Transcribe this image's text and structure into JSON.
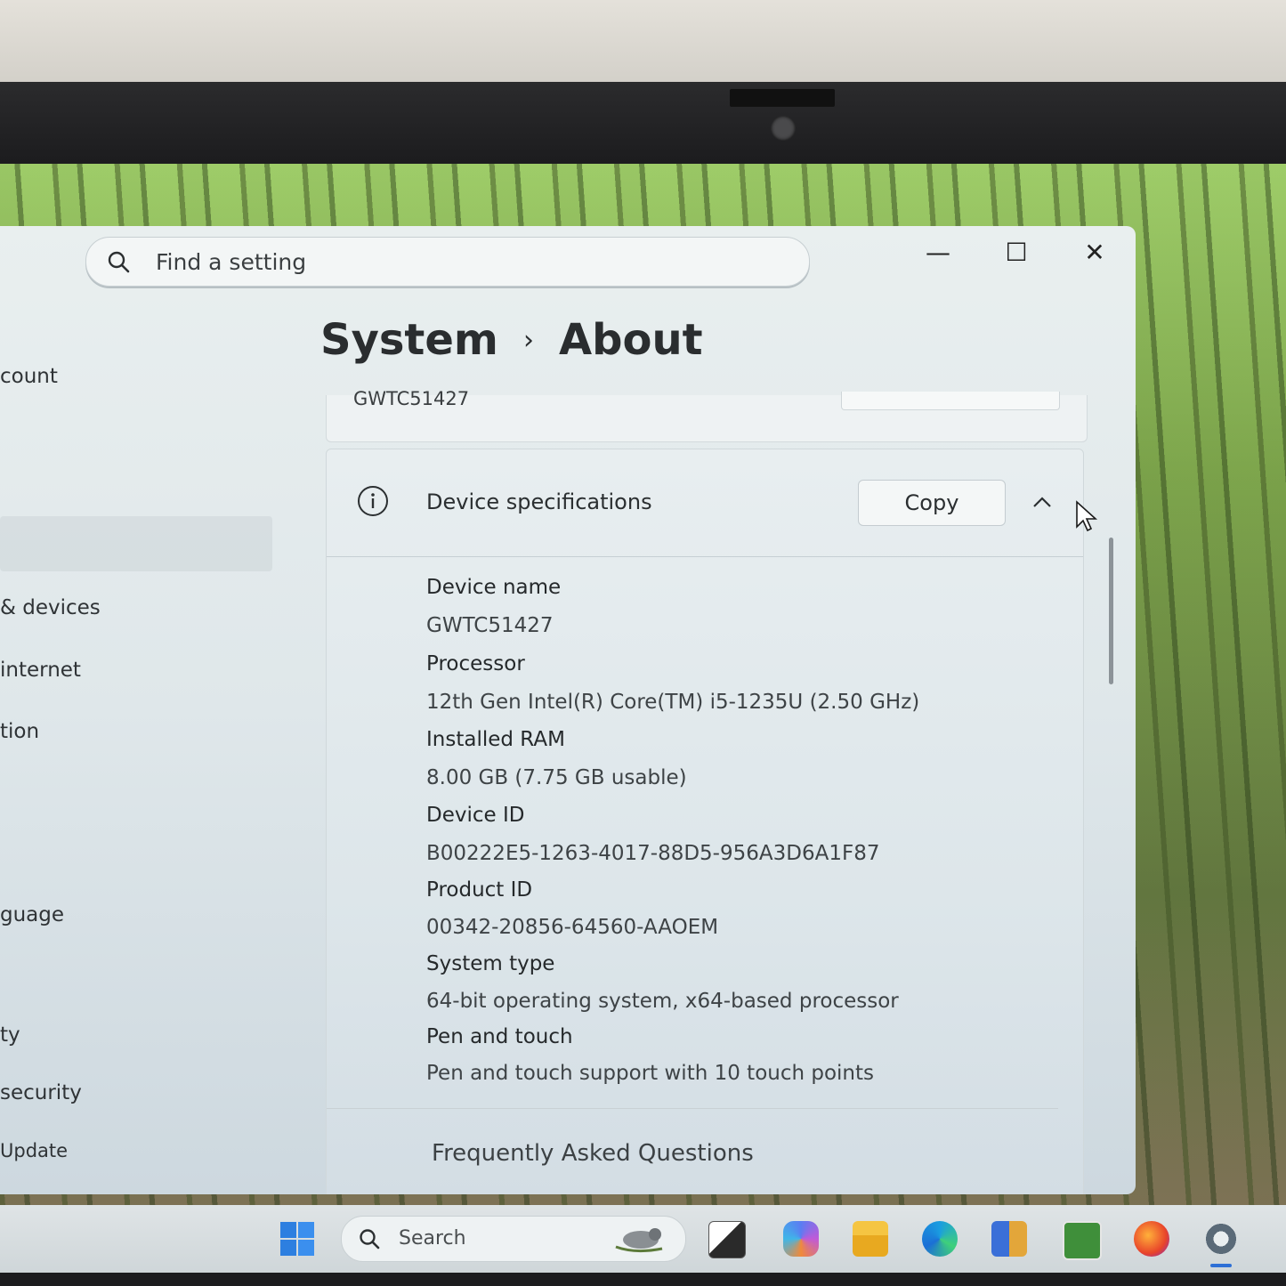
{
  "search": {
    "placeholder": "Find a setting"
  },
  "window_controls": {
    "minimize": "—",
    "maximize": "☐",
    "close": "✕"
  },
  "sidebar": {
    "items": [
      {
        "label": "count"
      },
      {
        "label": "& devices"
      },
      {
        "label": "internet"
      },
      {
        "label": "tion"
      },
      {
        "label": "guage"
      },
      {
        "label": "ty"
      },
      {
        "label": "security"
      },
      {
        "label": "Update"
      }
    ]
  },
  "breadcrumb": {
    "parent": "System",
    "separator": "›",
    "current": "About"
  },
  "top_card": {
    "device_name_value": "GWTC51427"
  },
  "specs": {
    "title": "Device specifications",
    "copy_label": "Copy",
    "rows": [
      {
        "label": "Device name",
        "value": "GWTC51427"
      },
      {
        "label": "Processor",
        "value": "12th Gen Intel(R) Core(TM) i5-1235U (2.50 GHz)"
      },
      {
        "label": "Installed RAM",
        "value": "8.00 GB (7.75 GB usable)"
      },
      {
        "label": "Device ID",
        "value": "B00222E5-1263-4017-88D5-956A3D6A1F87"
      },
      {
        "label": "Product ID",
        "value": "00342-20856-64560-AAOEM"
      },
      {
        "label": "System type",
        "value": "64-bit operating system, x64-based processor"
      },
      {
        "label": "Pen and touch",
        "value": "Pen and touch support with 10 touch points"
      }
    ]
  },
  "faq": {
    "label": "Frequently Asked Questions"
  },
  "taskbar": {
    "search_label": "Search"
  },
  "colors": {
    "accent": "#2d6fd6",
    "window_bg": "#e4ebee"
  },
  "icons": [
    "search-icon",
    "info-icon",
    "chevron-up-icon",
    "windows-start-icon",
    "task-view-icon",
    "copilot-icon",
    "file-explorer-icon",
    "edge-icon",
    "store-icon",
    "solitaire-icon",
    "firefox-icon",
    "settings-gear-icon"
  ]
}
